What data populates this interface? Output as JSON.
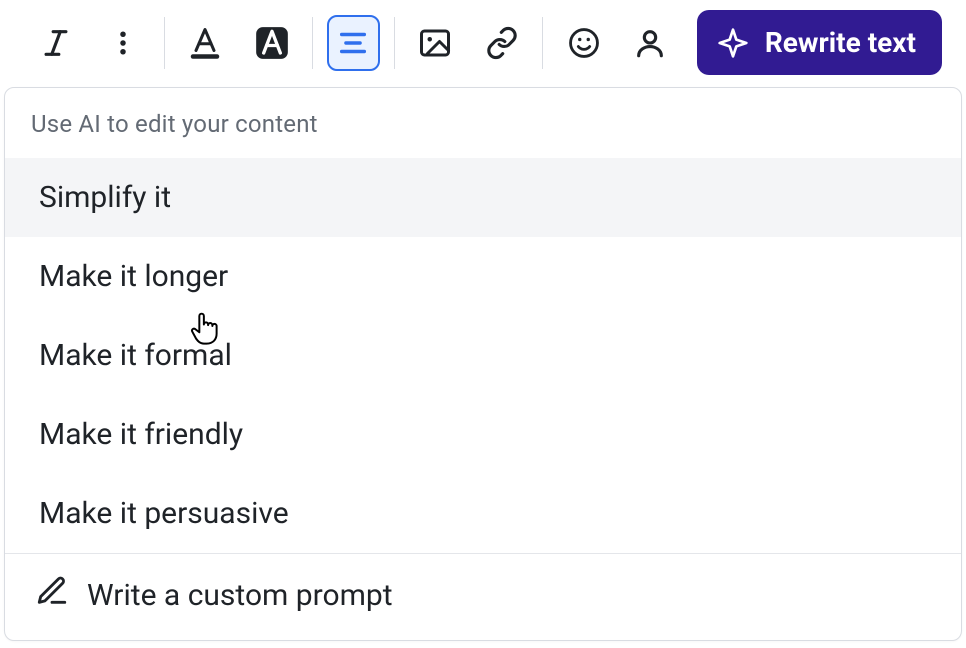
{
  "toolbar": {
    "italic_icon": "italic-icon",
    "kebab_icon": "kebab-icon",
    "text_color_icon": "text-color-icon",
    "highlight_icon": "highlight-icon",
    "align_icon": "align-center-icon",
    "image_icon": "image-icon",
    "link_icon": "link-icon",
    "emoji_icon": "smiley-icon",
    "person_icon": "person-icon",
    "rewrite_label": "Rewrite text",
    "sparkle_icon": "sparkle-icon"
  },
  "dropdown": {
    "header": "Use AI to edit your content",
    "items": [
      {
        "label": "Simplify it",
        "hovered": true
      },
      {
        "label": "Make it longer",
        "hovered": false
      },
      {
        "label": "Make it formal",
        "hovered": false
      },
      {
        "label": "Make it friendly",
        "hovered": false
      },
      {
        "label": "Make it persuasive",
        "hovered": false
      }
    ],
    "custom_prompt_label": "Write a custom prompt",
    "pencil_icon": "pencil-icon"
  }
}
